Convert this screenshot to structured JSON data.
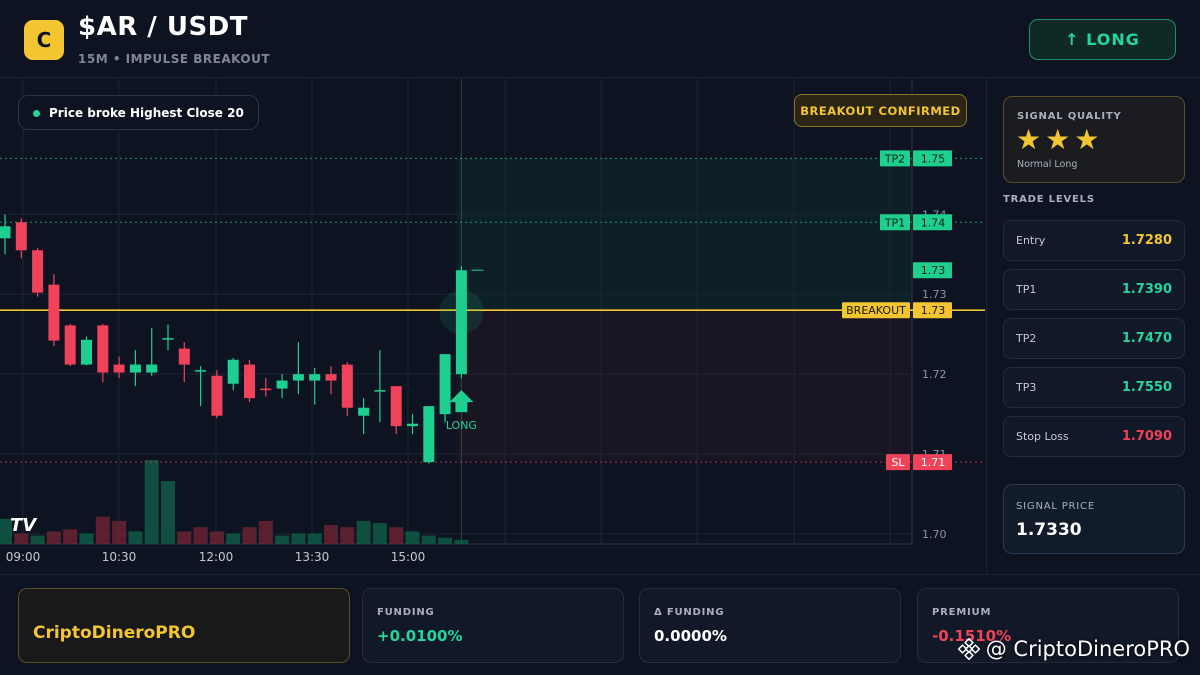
{
  "header": {
    "logo_letter": "C",
    "pair": "$AR / USDT",
    "subtitle": "15M • IMPULSE BREAKOUT",
    "direction_button": "↑ LONG"
  },
  "chart": {
    "alert_text": "Price broke Highest Close 20",
    "breakout_badge": "BREAKOUT CONFIRMED",
    "signal_marker": "LONG",
    "tv_logo": "TV"
  },
  "chart_data": {
    "type": "candlestick",
    "x_tick_labels": [
      "09:00",
      "10:30",
      "12:00",
      "13:30",
      "15:00"
    ],
    "y_tick_labels": [
      "1.74",
      "1.73",
      "1.72",
      "1.71",
      "1.70"
    ],
    "ylim": [
      1.6955,
      1.7568
    ],
    "level_lines": [
      {
        "label": "TP2",
        "value": 1.747,
        "tag": "1.75"
      },
      {
        "label": "TP1",
        "value": 1.739,
        "tag": "1.74"
      },
      {
        "label": "",
        "value": 1.733,
        "tag": "1.73"
      },
      {
        "label": "BREAKOUT",
        "value": 1.728,
        "tag": "1.73"
      },
      {
        "label": "SL",
        "value": 1.709,
        "tag": "1.71"
      }
    ],
    "candles": [
      {
        "o": 1.737,
        "h": 1.74,
        "l": 1.735,
        "c": 1.7385
      },
      {
        "o": 1.739,
        "h": 1.7395,
        "l": 1.7345,
        "c": 1.7355
      },
      {
        "o": 1.7355,
        "h": 1.7358,
        "l": 1.7297,
        "c": 1.7302
      },
      {
        "o": 1.7312,
        "h": 1.7325,
        "l": 1.7235,
        "c": 1.7242
      },
      {
        "o": 1.7261,
        "h": 1.7263,
        "l": 1.721,
        "c": 1.7212
      },
      {
        "o": 1.7212,
        "h": 1.7247,
        "l": 1.7211,
        "c": 1.7243
      },
      {
        "o": 1.7261,
        "h": 1.7263,
        "l": 1.719,
        "c": 1.7202
      },
      {
        "o": 1.7212,
        "h": 1.7222,
        "l": 1.7195,
        "c": 1.7202
      },
      {
        "o": 1.7202,
        "h": 1.723,
        "l": 1.7185,
        "c": 1.7212
      },
      {
        "o": 1.7202,
        "h": 1.7258,
        "l": 1.7198,
        "c": 1.7212
      },
      {
        "o": 1.7245,
        "h": 1.7262,
        "l": 1.723,
        "c": 1.7245
      },
      {
        "o": 1.7232,
        "h": 1.724,
        "l": 1.719,
        "c": 1.7212
      },
      {
        "o": 1.7205,
        "h": 1.721,
        "l": 1.716,
        "c": 1.7205
      },
      {
        "o": 1.7198,
        "h": 1.7205,
        "l": 1.7145,
        "c": 1.7148
      },
      {
        "o": 1.7188,
        "h": 1.722,
        "l": 1.718,
        "c": 1.7218
      },
      {
        "o": 1.7212,
        "h": 1.7218,
        "l": 1.7165,
        "c": 1.717
      },
      {
        "o": 1.7182,
        "h": 1.7195,
        "l": 1.7172,
        "c": 1.718
      },
      {
        "o": 1.7182,
        "h": 1.72,
        "l": 1.717,
        "c": 1.7192
      },
      {
        "o": 1.7192,
        "h": 1.724,
        "l": 1.7175,
        "c": 1.72
      },
      {
        "o": 1.7192,
        "h": 1.7208,
        "l": 1.7162,
        "c": 1.72
      },
      {
        "o": 1.72,
        "h": 1.721,
        "l": 1.7175,
        "c": 1.7192
      },
      {
        "o": 1.7212,
        "h": 1.7215,
        "l": 1.7148,
        "c": 1.7158
      },
      {
        "o": 1.7148,
        "h": 1.717,
        "l": 1.7125,
        "c": 1.7158
      },
      {
        "o": 1.718,
        "h": 1.723,
        "l": 1.714,
        "c": 1.718
      },
      {
        "o": 1.7185,
        "h": 1.7185,
        "l": 1.7125,
        "c": 1.7135
      },
      {
        "o": 1.7135,
        "h": 1.715,
        "l": 1.7125,
        "c": 1.7138
      },
      {
        "o": 1.709,
        "h": 1.716,
        "l": 1.7088,
        "c": 1.716
      },
      {
        "o": 1.715,
        "h": 1.7225,
        "l": 1.714,
        "c": 1.7225
      },
      {
        "o": 1.72,
        "h": 1.7335,
        "l": 1.7195,
        "c": 1.733
      }
    ],
    "volume": [
      1.2,
      0.5,
      0.4,
      0.6,
      0.7,
      0.5,
      1.3,
      1.1,
      0.6,
      4.0,
      3.0,
      0.6,
      0.8,
      0.6,
      0.5,
      0.8,
      1.1,
      0.4,
      0.5,
      0.5,
      0.9,
      0.8,
      1.1,
      1.0,
      0.8,
      0.6,
      0.4,
      0.3,
      0.2
    ],
    "volume_up": [
      true,
      false,
      true,
      false,
      false,
      true,
      false,
      false,
      true,
      true,
      true,
      false,
      false,
      false,
      true,
      false,
      false,
      true,
      true,
      true,
      false,
      false,
      true,
      true,
      false,
      true,
      true,
      true,
      true
    ]
  },
  "sidebar": {
    "quality_title": "SIGNAL QUALITY",
    "stars": "★★★",
    "quality_sub": "Normal Long",
    "levels_title": "TRADE LEVELS",
    "levels": [
      {
        "label": "Entry",
        "value": "1.7280",
        "color": "#f3c530"
      },
      {
        "label": "TP1",
        "value": "1.7390",
        "color": "#24d69b"
      },
      {
        "label": "TP2",
        "value": "1.7470",
        "color": "#24d69b"
      },
      {
        "label": "TP3",
        "value": "1.7550",
        "color": "#24d69b"
      },
      {
        "label": "Stop Loss",
        "value": "1.7090",
        "color": "#f0435a"
      }
    ],
    "signal_price_label": "SIGNAL PRICE",
    "signal_price": "1.7330"
  },
  "footer": {
    "brand": "CriptoDineroPRO",
    "stats": [
      {
        "label": "FUNDING",
        "value": "+0.0100%",
        "color": "#24d69b"
      },
      {
        "label": "Δ FUNDING",
        "value": "0.0000%",
        "color": "#ffffff"
      },
      {
        "label": "PREMIUM",
        "value": "-0.1510%",
        "color": "#f0435a"
      }
    ],
    "watermark": "@ CriptoDineroPRO"
  },
  "colors": {
    "up": "#1fcf8f",
    "down": "#f0435a",
    "accent": "#f3c530"
  }
}
